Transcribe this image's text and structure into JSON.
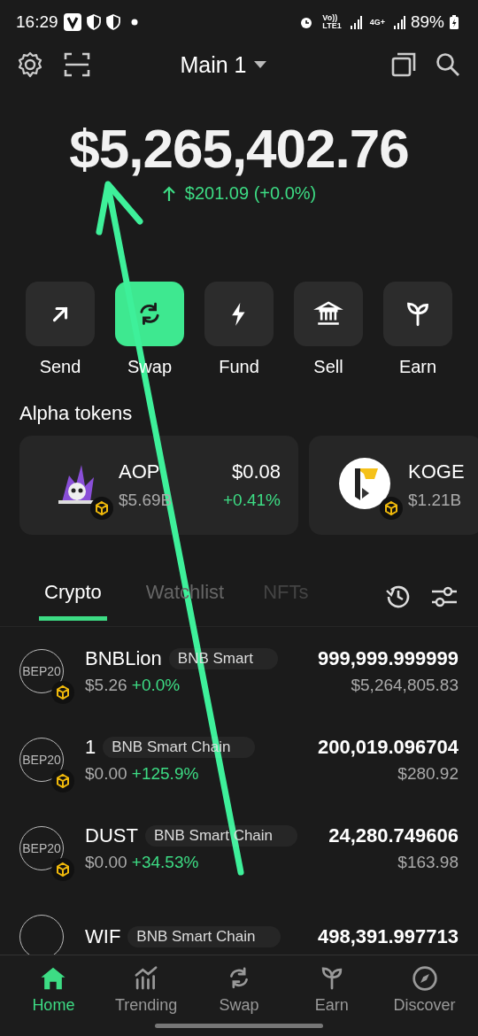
{
  "status_bar": {
    "time": "16:29",
    "volte": "Vo))",
    "lte": "LTE1",
    "network": "4G+",
    "battery": "89%"
  },
  "header": {
    "wallet": "Main 1"
  },
  "balance": {
    "total": "$5,265,402.76",
    "change": "$201.09 (+0.0%)"
  },
  "actions": [
    {
      "kind": "send",
      "label": "Send",
      "highlighted": false
    },
    {
      "kind": "swap",
      "label": "Swap",
      "highlighted": true
    },
    {
      "kind": "fund",
      "label": "Fund",
      "highlighted": false
    },
    {
      "kind": "sell",
      "label": "Sell",
      "highlighted": false
    },
    {
      "kind": "earn",
      "label": "Earn",
      "highlighted": false
    }
  ],
  "alpha_tokens": {
    "title": "Alpha tokens",
    "items": [
      {
        "kind": "aop",
        "symbol": "AOP",
        "market_cap": "$5.69B",
        "price": "$0.08",
        "change": "+0.41%"
      },
      {
        "kind": "koge",
        "symbol": "KOGE",
        "market_cap": "$1.21B"
      }
    ]
  },
  "tabs": [
    {
      "label": "Crypto",
      "selected": true
    },
    {
      "label": "Watchlist",
      "selected": false
    },
    {
      "label": "NFTs",
      "selected": false
    }
  ],
  "assets": [
    {
      "icon": "BEP20",
      "name": "BNBLion",
      "chain": "BNB Smart",
      "price": "$5.26",
      "change": "+0.0%",
      "amount": "999,999.999999",
      "value": "$5,264,805.83"
    },
    {
      "icon": "BEP20",
      "name": "1",
      "chain": "BNB Smart Chain",
      "price": "$0.00",
      "change": "+125.9%",
      "amount": "200,019.096704",
      "value": "$280.92"
    },
    {
      "icon": "BEP20",
      "name": "DUST",
      "chain": "BNB Smart Chain",
      "price": "$0.00",
      "change": "+34.53%",
      "amount": "24,280.749606",
      "value": "$163.98"
    },
    {
      "name": "WIF",
      "chain": "BNB Smart Chain",
      "amount": "498,391.997713"
    }
  ],
  "nav": [
    {
      "kind": "home",
      "label": "Home",
      "selected": true
    },
    {
      "kind": "trending",
      "label": "Trending",
      "selected": false
    },
    {
      "kind": "swap",
      "label": "Swap",
      "selected": false
    },
    {
      "kind": "earn",
      "label": "Earn",
      "selected": false
    },
    {
      "kind": "discover",
      "label": "Discover",
      "selected": false
    }
  ]
}
